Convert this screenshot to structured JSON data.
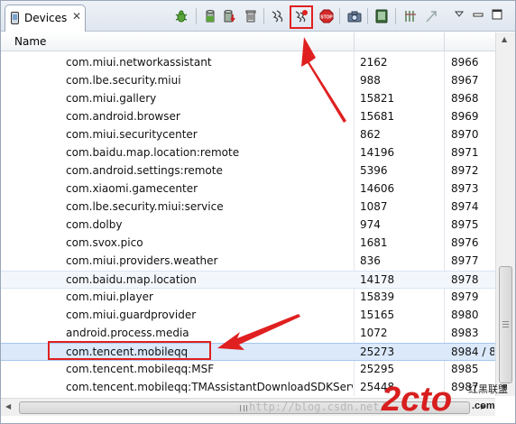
{
  "tab": {
    "label": "Devices",
    "icon": "device-phone-icon",
    "close_icon": "close-icon"
  },
  "toolbar": {
    "icons": [
      "debug-bug-icon",
      "update-heap-icon",
      "dump-hprof-icon",
      "cause-gc-icon",
      "update-threads-icon",
      "start-method-profiling-icon",
      "stop-process-icon",
      "screen-capture-icon",
      "dump-view-hierarchy-icon",
      "systrace-icon",
      "opengl-trace-icon",
      "view-menu-icon",
      "minimize-icon",
      "maximize-icon"
    ]
  },
  "table": {
    "header": {
      "name": "Name"
    },
    "rows": [
      {
        "name": "com.miui.networkassistant",
        "pid": "2162",
        "port": "8966"
      },
      {
        "name": "com.lbe.security.miui",
        "pid": "988",
        "port": "8967"
      },
      {
        "name": "com.miui.gallery",
        "pid": "15821",
        "port": "8968"
      },
      {
        "name": "com.android.browser",
        "pid": "15681",
        "port": "8969"
      },
      {
        "name": "com.miui.securitycenter",
        "pid": "862",
        "port": "8970"
      },
      {
        "name": "com.baidu.map.location:remote",
        "pid": "14196",
        "port": "8971"
      },
      {
        "name": "com.android.settings:remote",
        "pid": "5396",
        "port": "8972"
      },
      {
        "name": "com.xiaomi.gamecenter",
        "pid": "14606",
        "port": "8973"
      },
      {
        "name": "com.lbe.security.miui:service",
        "pid": "1087",
        "port": "8974"
      },
      {
        "name": "com.dolby",
        "pid": "974",
        "port": "8975"
      },
      {
        "name": "com.svox.pico",
        "pid": "1681",
        "port": "8976"
      },
      {
        "name": "com.miui.providers.weather",
        "pid": "836",
        "port": "8977"
      },
      {
        "name": "com.baidu.map.location",
        "pid": "14178",
        "port": "8978"
      },
      {
        "name": "com.miui.player",
        "pid": "15839",
        "port": "8979"
      },
      {
        "name": "com.miui.guardprovider",
        "pid": "15165",
        "port": "8980"
      },
      {
        "name": "android.process.media",
        "pid": "1072",
        "port": "8983"
      },
      {
        "name": "com.tencent.mobileqq",
        "pid": "25273",
        "port": "8984 / 8"
      },
      {
        "name": "com.tencent.mobileqq:MSF",
        "pid": "25295",
        "port": "8985"
      },
      {
        "name": "com.tencent.mobileqq:TMAssistantDownloadSDKService",
        "pid": "25448",
        "port": "8987"
      }
    ]
  },
  "watermark": {
    "text": "http://blog.csdn.net/"
  },
  "logo": {
    "main": "2cto",
    "suffix": ".com",
    "cn": "红黑联盟"
  },
  "colors": {
    "annotation": "#e02020",
    "selection": "#dbe9fb"
  }
}
